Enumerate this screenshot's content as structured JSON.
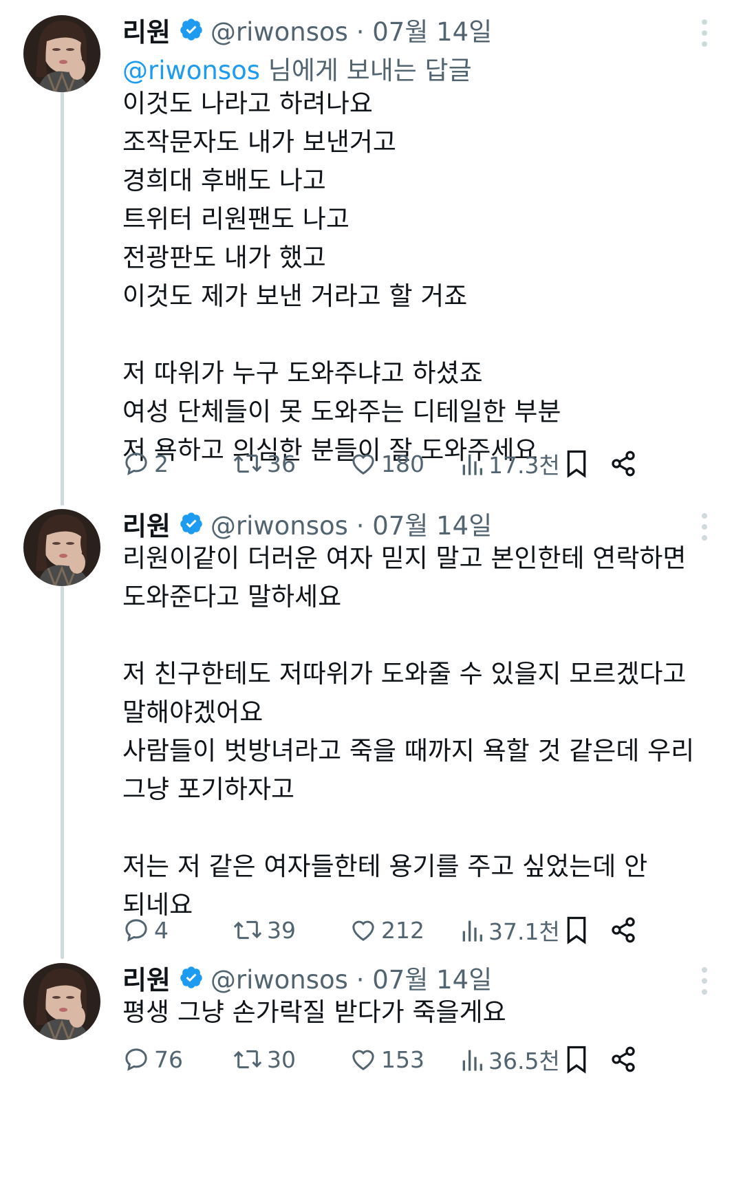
{
  "tweets": [
    {
      "name": "리원",
      "handle": "@riwonsos · 07월 14일",
      "reply_mention": "@riwonsos",
      "reply_suffix": " 님에게 보내는 답글",
      "lines": [
        "이것도 나라고 하려나요",
        "조작문자도 내가 보낸거고",
        "경희대 후배도 나고",
        "트위터 리원팬도 나고",
        "전광판도 내가 했고",
        "이것도 제가 보낸 거라고 할 거죠",
        "",
        "저 따위가 누구 도와주냐고 하셨죠",
        "여성 단체들이 못 도와주는 디테일한 부분",
        "저 욕하고 의심한 분들이 잘 도와주세요"
      ],
      "replies": "2",
      "retweets": "36",
      "likes": "180",
      "views": "17.3천"
    },
    {
      "name": "리원",
      "handle": "@riwonsos · 07월 14일",
      "lines": [
        "리원이같이 더러운 여자 믿지 말고 본인한테 연락하면",
        "도와준다고 말하세요",
        "",
        "저 친구한테도 저따위가 도와줄 수 있을지 모르겠다고",
        "말해야겠어요",
        "사람들이 벗방녀라고 죽을 때까지 욕할 것 같은데 우리",
        "그냥 포기하자고",
        "",
        "저는 저 같은 여자들한테 용기를 주고 싶었는데 안",
        "되네요"
      ],
      "replies": "4",
      "retweets": "39",
      "likes": "212",
      "views": "37.1천"
    },
    {
      "name": "리원",
      "handle": "@riwonsos · 07월 14일",
      "lines": [
        "평생 그냥 손가락질 받다가 죽을게요"
      ],
      "replies": "76",
      "retweets": "30",
      "likes": "153",
      "views": "36.5천"
    }
  ],
  "icons": {
    "verified": "verified-badge-icon",
    "reply": "reply-icon",
    "retweet": "retweet-icon",
    "like": "heart-icon",
    "views": "views-icon",
    "bookmark": "bookmark-icon",
    "share": "share-icon",
    "more": "more-icon"
  },
  "colors": {
    "accent": "#1d9bf0",
    "secondary_text": "#536471",
    "thread_line": "#cfd9de"
  }
}
